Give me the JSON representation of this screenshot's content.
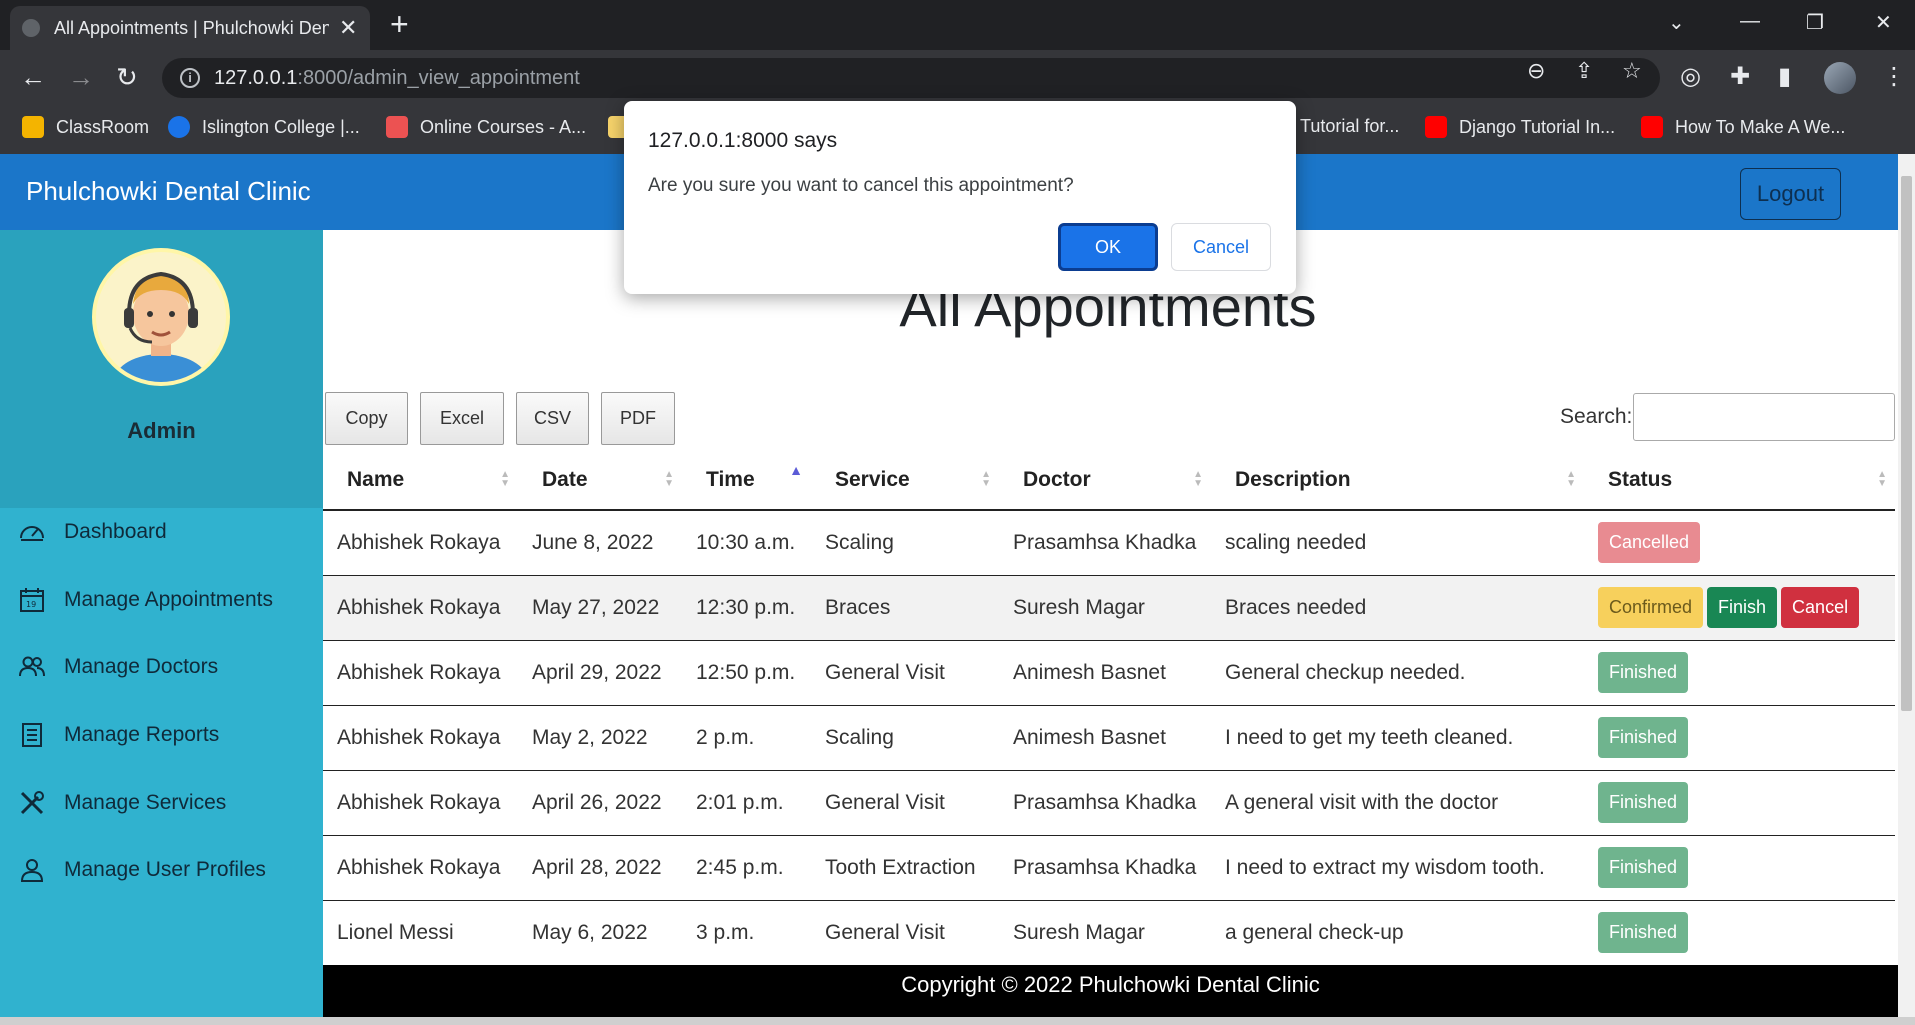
{
  "browser": {
    "tab_title": "All Appointments | Phulchowki Dental Clinic",
    "url_host": "127.0.0.1",
    "url_rest": ":8000/admin_view_appointment",
    "bookmarks": [
      {
        "label": "ClassRoom",
        "color": "#f4b400"
      },
      {
        "label": "Islington College |...",
        "color": "#1a73e8"
      },
      {
        "label": "Online Courses - A...",
        "color": "#ec5252"
      },
      {
        "label": "Tutorial for...",
        "color": "#35363a"
      },
      {
        "label": "Django Tutorial In...",
        "color": "#ff0000"
      },
      {
        "label": "How To Make A We...",
        "color": "#ff0000"
      }
    ]
  },
  "navbar": {
    "brand": "Phulchowki Dental Clinic",
    "logout_label": "Logout",
    "color": "#1b76c9"
  },
  "sidebar": {
    "username": "Admin",
    "items": [
      {
        "label": "Dashboard",
        "icon": "dashboard-icon"
      },
      {
        "label": "Manage Appointments",
        "icon": "calendar-icon"
      },
      {
        "label": "Manage Doctors",
        "icon": "users-icon"
      },
      {
        "label": "Manage Reports",
        "icon": "report-icon"
      },
      {
        "label": "Manage Services",
        "icon": "tools-icon"
      },
      {
        "label": "Manage User Profiles",
        "icon": "user-icon"
      }
    ]
  },
  "main": {
    "title": "All Appointments",
    "export_buttons": [
      "Copy",
      "Excel",
      "CSV",
      "PDF"
    ],
    "search_label": "Search:",
    "search_value": "",
    "columns": [
      "Name",
      "Date",
      "Time",
      "Service",
      "Doctor",
      "Description",
      "Status"
    ],
    "rows": [
      {
        "name": "Abhishek Rokaya",
        "date": "June 8, 2022",
        "time": "10:30 a.m.",
        "service": "Scaling",
        "doctor": "Prasamhsa Khadka",
        "description": "scaling needed",
        "status": "Cancelled"
      },
      {
        "name": "Abhishek Rokaya",
        "date": "May 27, 2022",
        "time": "12:30 p.m.",
        "service": "Braces",
        "doctor": "Suresh Magar",
        "description": "Braces needed",
        "status": "Confirmed",
        "actions": [
          "Finish",
          "Cancel"
        ]
      },
      {
        "name": "Abhishek Rokaya",
        "date": "April 29, 2022",
        "time": "12:50 p.m.",
        "service": "General Visit",
        "doctor": "Animesh Basnet",
        "description": "General checkup needed.",
        "status": "Finished"
      },
      {
        "name": "Abhishek Rokaya",
        "date": "May 2, 2022",
        "time": "2 p.m.",
        "service": "Scaling",
        "doctor": "Animesh Basnet",
        "description": "I need to get my teeth cleaned.",
        "status": "Finished"
      },
      {
        "name": "Abhishek Rokaya",
        "date": "April 26, 2022",
        "time": "2:01 p.m.",
        "service": "General Visit",
        "doctor": "Prasamhsa Khadka",
        "description": "A general visit with the doctor",
        "status": "Finished"
      },
      {
        "name": "Abhishek Rokaya",
        "date": "April 28, 2022",
        "time": "2:45 p.m.",
        "service": "Tooth Extraction",
        "doctor": "Prasamhsa Khadka",
        "description": "I need to extract my wisdom tooth.",
        "status": "Finished"
      },
      {
        "name": "Lionel Messi",
        "date": "May 6, 2022",
        "time": "3 p.m.",
        "service": "General Visit",
        "doctor": "Suresh Magar",
        "description": "a general check-up",
        "status": "Finished"
      }
    ]
  },
  "footer": {
    "text": "Copyright © 2022 Phulchowki Dental Clinic"
  },
  "dialog": {
    "title": "127.0.0.1:8000 says",
    "message": "Are you sure you want to cancel this appointment?",
    "ok_label": "OK",
    "cancel_label": "Cancel"
  }
}
